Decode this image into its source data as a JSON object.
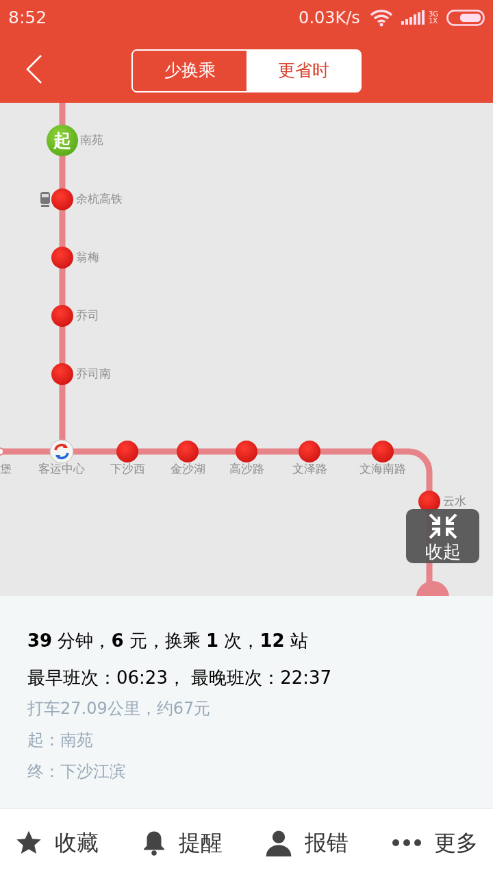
{
  "status_bar": {
    "time": "8:52",
    "speed": "0.03K/s",
    "network_top": "3G",
    "network_bottom": "1X"
  },
  "header": {
    "tabs": [
      {
        "label": "少换乘",
        "selected": true
      },
      {
        "label": "更省时",
        "selected": false
      }
    ]
  },
  "map": {
    "stations": [
      {
        "kind": "start",
        "marker": "起",
        "label": "南苑"
      },
      {
        "kind": "rail",
        "label": "余杭高铁"
      },
      {
        "kind": "normal",
        "label": "翁梅"
      },
      {
        "kind": "normal",
        "label": "乔司"
      },
      {
        "kind": "normal",
        "label": "乔司南"
      },
      {
        "kind": "edge",
        "label": "堡"
      },
      {
        "kind": "transfer",
        "label": "客运中心"
      },
      {
        "kind": "normal",
        "label": "下沙西"
      },
      {
        "kind": "normal",
        "label": "金沙湖"
      },
      {
        "kind": "normal",
        "label": "高沙路"
      },
      {
        "kind": "normal",
        "label": "文泽路"
      },
      {
        "kind": "normal",
        "label": "文海南路"
      },
      {
        "kind": "normal",
        "label": "云水"
      }
    ],
    "collapse_button": "收起"
  },
  "summary": {
    "headline": "**39** 分钟，**6** 元，换乘 **1** 次，**12** 站",
    "schedule": "最早班次：06:23， 最晚班次：22:37",
    "taxi": "打车27.09公里，约67元",
    "origin": "起：南苑",
    "destination": "终：下沙江滨"
  },
  "actions": [
    {
      "kind": "star",
      "label": "收藏"
    },
    {
      "kind": "bell",
      "label": "提醒"
    },
    {
      "kind": "person",
      "label": "报错"
    },
    {
      "kind": "more",
      "label": "更多"
    }
  ]
}
